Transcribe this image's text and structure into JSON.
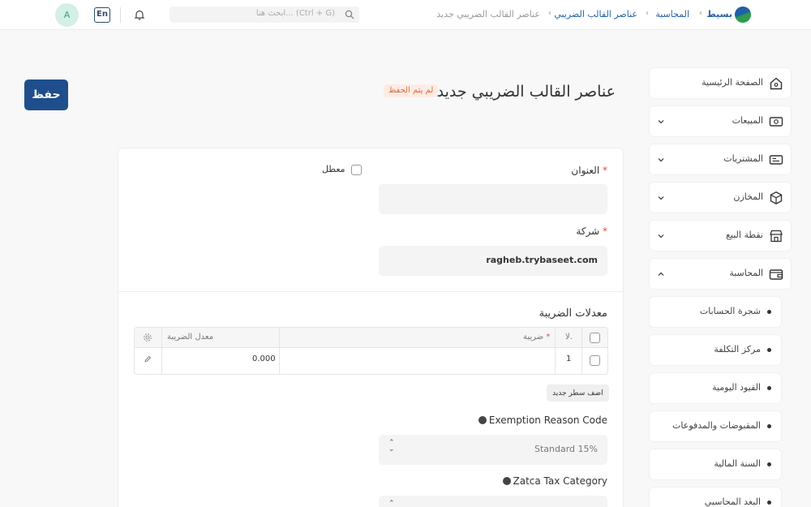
{
  "topbar": {
    "breadcrumbs": [
      "بسيط",
      "المحاسبة",
      "عناصر القالب الضريبي",
      "عناصر القالب الضريبي جديد"
    ],
    "search_placeholder": "ابحث هنا... (Ctrl + G)",
    "lang": "En",
    "avatar": "A"
  },
  "page": {
    "title": "عناصر القالب الضريبي جديد",
    "status": "لم يتم الحفظ",
    "save_label": "حفظ"
  },
  "sidebar": {
    "items": [
      {
        "label": "الصفحة الرئيسية",
        "icon": "home-icon"
      },
      {
        "label": "المبيعات",
        "icon": "cash-icon"
      },
      {
        "label": "المشتريات",
        "icon": "receipt-icon"
      },
      {
        "label": "المخازن",
        "icon": "box-icon"
      },
      {
        "label": "نقطة البيع",
        "icon": "store-icon"
      },
      {
        "label": "المحاسبة",
        "icon": "wallet-icon"
      }
    ],
    "sub_items": [
      "شجرة الحسابات",
      "مركز التكلفة",
      "القيود اليومية",
      "المقبوضات والمدفوعات",
      "السنة المالية",
      "البعد المحاسبي"
    ]
  },
  "form": {
    "title_label": "العنوان",
    "title_value": "",
    "disabled_label": "معطل",
    "company_label": "شركة",
    "company_value": "ragheb.trybaseet.com",
    "tax_rates_title": "معدلات الضريبة",
    "table": {
      "headers": {
        "no": "لا.",
        "tax": "ضريبة",
        "rate": "معدل الضريبة"
      },
      "rows": [
        {
          "no": "1",
          "tax": "",
          "rate": "0.000"
        }
      ]
    },
    "add_row_label": "اضف سطر جديد",
    "exemption_label": "Exemption Reason Code",
    "exemption_value": "Standard 15%",
    "zatca_label": "Zatca Tax Category"
  }
}
